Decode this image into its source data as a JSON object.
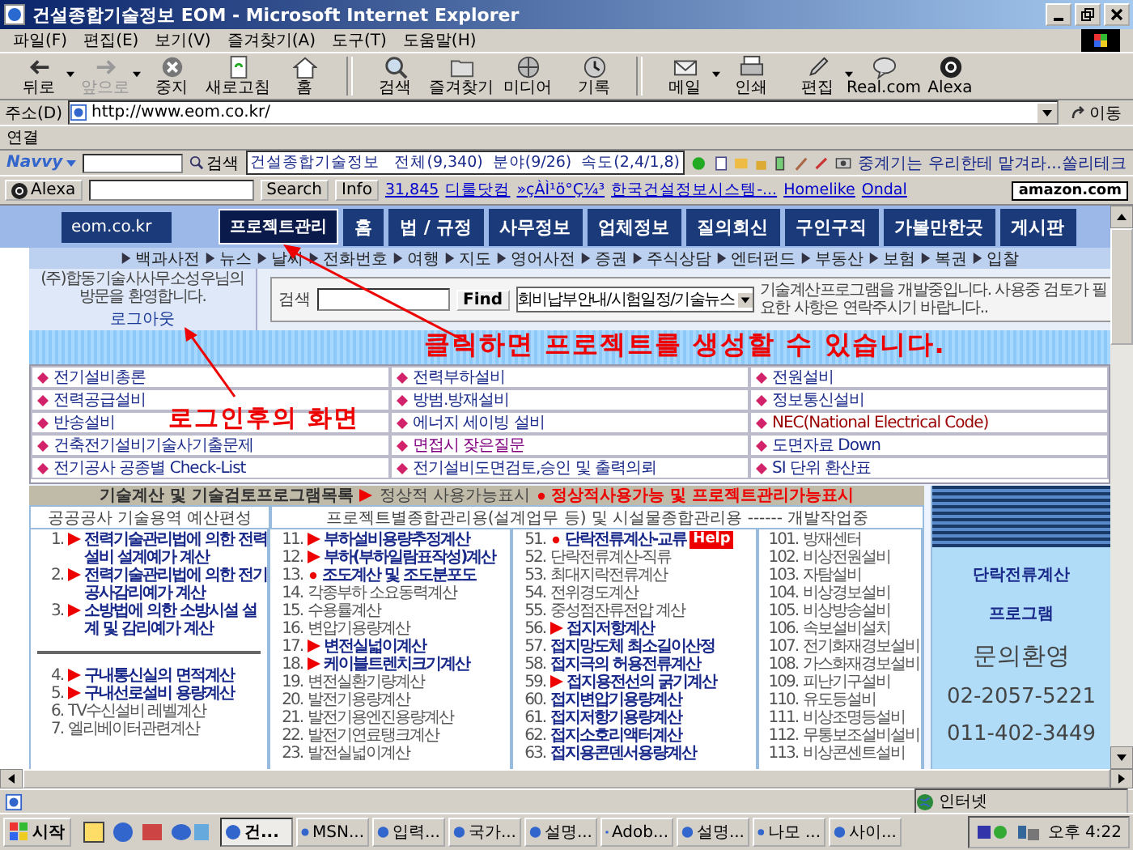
{
  "window": {
    "title": "건설종합기술정보 EOM - Microsoft Internet Explorer"
  },
  "menu": [
    "파일(F)",
    "편집(E)",
    "보기(V)",
    "즐겨찾기(A)",
    "도구(T)",
    "도움말(H)"
  ],
  "toolbar": [
    {
      "label": "뒤로",
      "disabled": false,
      "dropdown": true
    },
    {
      "label": "앞으로",
      "disabled": true,
      "dropdown": true
    },
    {
      "label": "중지",
      "disabled": false,
      "dropdown": false
    },
    {
      "label": "새로고침",
      "disabled": false,
      "dropdown": false
    },
    {
      "label": "홈",
      "disabled": false,
      "dropdown": false
    },
    {
      "label": "검색",
      "disabled": false,
      "dropdown": false
    },
    {
      "label": "즐겨찾기",
      "disabled": false,
      "dropdown": false
    },
    {
      "label": "미디어",
      "disabled": false,
      "dropdown": false
    },
    {
      "label": "기록",
      "disabled": false,
      "dropdown": false
    },
    {
      "label": "메일",
      "disabled": false,
      "dropdown": true
    },
    {
      "label": "인쇄",
      "disabled": false,
      "dropdown": false
    },
    {
      "label": "편집",
      "disabled": false,
      "dropdown": true
    },
    {
      "label": "Real.com",
      "disabled": false,
      "dropdown": false
    },
    {
      "label": "Alexa",
      "disabled": false,
      "dropdown": false
    }
  ],
  "address": {
    "label": "주소(D)",
    "value": "http://www.eom.co.kr/",
    "go": "이동"
  },
  "links_bar": {
    "label": "연결"
  },
  "navvy_bar": {
    "brand": "Navvy",
    "search": "검색",
    "info": "건설종합기술정보   전체(9,340)  분야(9/26)  속도(2,4/1,8)",
    "ticker": "중계기는 우리한테 맡겨라...쏠리테크"
  },
  "alexa_bar": {
    "brand": "Alexa",
    "search": "Search",
    "info": "Info",
    "rank": "31,845",
    "links": [
      "디룰닷컴",
      "»çÀÌ¹ö°Ç¼³",
      "한국건설정보시스템-...",
      "Homelike",
      "Ondal"
    ],
    "amazon": "amazon.com"
  },
  "site": {
    "domain": "eom.co.kr",
    "tabs": [
      {
        "label": "프로젝트관리",
        "selected": true
      },
      {
        "label": "홈",
        "selected": false
      },
      {
        "label": "법 / 규정",
        "selected": false
      },
      {
        "label": "사무정보",
        "selected": false
      },
      {
        "label": "업체정보",
        "selected": false
      },
      {
        "label": "질의회신",
        "selected": false
      },
      {
        "label": "구인구직",
        "selected": false
      },
      {
        "label": "가볼만한곳",
        "selected": false
      },
      {
        "label": "게시판",
        "selected": false
      }
    ],
    "subnav": [
      "백과사전",
      "뉴스",
      "날씨",
      "전화번호",
      "여행",
      "지도",
      "영어사전",
      "증권",
      "주식상담",
      "엔터펀드",
      "부동산",
      "보험",
      "복권",
      "입찰"
    ],
    "login": {
      "greeting": "(주)합동기술사사무소성우님의 방문을 환영합니다.",
      "logout": "로그아웃"
    },
    "search": {
      "label": "검색",
      "button": "Find",
      "select": "회비납부안내/시험일정/기술뉴스",
      "notice": "기술계산프로그램을 개발중입니다. 사용중 검토가 필요한 사항은 연락주시기 바랍니다.."
    },
    "link_grid": [
      [
        {
          "text": "전기설비총론",
          "color": "#1a2a8a"
        },
        {
          "text": "전력부하설비",
          "color": "#1a2a8a"
        },
        {
          "text": "전원설비",
          "color": "#1a2a8a"
        }
      ],
      [
        {
          "text": "전력공급설비",
          "color": "#1a2a8a"
        },
        {
          "text": "방범.방재설비",
          "color": "#1a2a8a"
        },
        {
          "text": "정보통신설비",
          "color": "#1a2a8a"
        }
      ],
      [
        {
          "text": "반송설비",
          "color": "#1a2a8a"
        },
        {
          "text": "에너지 세이빙 설비",
          "color": "#1a2a8a"
        },
        {
          "text": "NEC(National Electrical Code)",
          "color": "#990000"
        }
      ],
      [
        {
          "text": "건축전기설비기술사기출문제",
          "color": "#1a2a8a"
        },
        {
          "text": "면접시 잦은질문",
          "color": "#800080"
        },
        {
          "text": "도면자료 Down",
          "color": "#1a2a8a"
        }
      ],
      [
        {
          "text": "전기공사 공종별 Check-List",
          "color": "#1a2a8a"
        },
        {
          "text": "전기설비도면검토,승인 및 출력의뢰",
          "color": "#1a2a8a"
        },
        {
          "text": "SI 단위 환산표",
          "color": "#1a2a8a"
        }
      ]
    ],
    "programs": {
      "title": "기술계산 및 기술검토프로그램목록",
      "legend_arrow": "정상적 사용가능표시",
      "legend_dot": "정상적사용가능 및 프로젝트관리가능표시",
      "headings": [
        "공공공사 기술용역 예산편성",
        "프로젝트별종합관리용(설계업무 등) 및 시설물종합관리용 ------ 개발작업중"
      ],
      "columns": [
        {
          "groups": [
            [
              {
                "num": "1.",
                "text": "전력기술관리법에 의한 전력설비 설계예가 계산",
                "kind": "arrow",
                "link": true
              },
              {
                "num": "2.",
                "text": "전력기술관리법에 의한 전기공사감리예가 계산",
                "kind": "arrow",
                "link": true
              },
              {
                "num": "3.",
                "text": "소방법에 의한 소방시설 설계 및 감리예가 계산",
                "kind": "arrow",
                "link": true
              }
            ],
            [
              {
                "num": "4.",
                "text": "구내통신실의 면적계산",
                "kind": "arrow",
                "link": true
              },
              {
                "num": "5.",
                "text": "구내선로설비 용량계산",
                "kind": "arrow",
                "link": true
              },
              {
                "num": "6.",
                "text": "TV수신설비 레벨계산",
                "kind": "plain",
                "link": false
              },
              {
                "num": "7.",
                "text": "엘리베이터관련계산",
                "kind": "plain",
                "link": false
              }
            ]
          ]
        },
        {
          "groups": [
            [
              {
                "num": "11.",
                "text": "부하설비용량추정계산",
                "kind": "arrow",
                "link": true
              },
              {
                "num": "12.",
                "text": "부하(부하일람표작성)계산",
                "kind": "arrow",
                "link": true
              },
              {
                "num": "13.",
                "text": "조도계산 및 조도분포도",
                "kind": "dot",
                "link": true
              },
              {
                "num": "14.",
                "text": "각종부하 소요동력계산",
                "kind": "plain",
                "link": false
              },
              {
                "num": "15.",
                "text": "수용률계산",
                "kind": "plain",
                "link": false
              },
              {
                "num": "16.",
                "text": "변압기용량계산",
                "kind": "plain",
                "link": false
              },
              {
                "num": "17.",
                "text": "변전실넓이계산",
                "kind": "arrow",
                "link": true
              },
              {
                "num": "18.",
                "text": "케이블트렌치크기계산",
                "kind": "arrow",
                "link": true
              },
              {
                "num": "19.",
                "text": "변전실환기량계산",
                "kind": "plain",
                "link": false
              },
              {
                "num": "20.",
                "text": "발전기용량계산",
                "kind": "plain",
                "link": false
              },
              {
                "num": "21.",
                "text": "발전기용엔진용량계산",
                "kind": "plain",
                "link": false
              },
              {
                "num": "22.",
                "text": "발전기연료탱크계산",
                "kind": "plain",
                "link": false
              },
              {
                "num": "23.",
                "text": "발전실넓이계산",
                "kind": "plain",
                "link": false
              }
            ]
          ]
        },
        {
          "groups": [
            [
              {
                "num": "51.",
                "text": "단락전류계산-교류",
                "kind": "dot",
                "link": true,
                "badge": "Help"
              },
              {
                "num": "52.",
                "text": "단락전류계산-직류",
                "kind": "plain",
                "link": false
              },
              {
                "num": "53.",
                "text": "최대지락전류계산",
                "kind": "plain",
                "link": false
              },
              {
                "num": "54.",
                "text": "전위경도계산",
                "kind": "plain",
                "link": false
              },
              {
                "num": "55.",
                "text": "중성점잔류전압 계산",
                "kind": "plain",
                "link": false
              },
              {
                "num": "56.",
                "text": "접지저항계산",
                "kind": "arrow",
                "link": true
              },
              {
                "num": "57.",
                "text": "접지망도체 최소길이산정",
                "kind": "plain",
                "link": true
              },
              {
                "num": "58.",
                "text": "접지극의 허용전류계산",
                "kind": "plain",
                "link": true
              },
              {
                "num": "59.",
                "text": "접지용전선의 굵기계산",
                "kind": "arrow",
                "link": true
              },
              {
                "num": "60.",
                "text": "접지변압기용량계산",
                "kind": "plain",
                "link": true
              },
              {
                "num": "61.",
                "text": "접지저항기용량계산",
                "kind": "plain",
                "link": true
              },
              {
                "num": "62.",
                "text": "접지소호리액터계산",
                "kind": "plain",
                "link": true
              },
              {
                "num": "63.",
                "text": "접지용콘덴서용량계산",
                "kind": "plain",
                "link": true
              }
            ]
          ]
        },
        {
          "groups": [
            [
              {
                "num": "101.",
                "text": "방재센터",
                "kind": "plain",
                "link": false
              },
              {
                "num": "102.",
                "text": "비상전원설비",
                "kind": "plain",
                "link": false
              },
              {
                "num": "103.",
                "text": "자탐설비",
                "kind": "plain",
                "link": false
              },
              {
                "num": "104.",
                "text": "비상경보설비",
                "kind": "plain",
                "link": false
              },
              {
                "num": "105.",
                "text": "비상방송설비",
                "kind": "plain",
                "link": false
              },
              {
                "num": "106.",
                "text": "속보설비설치",
                "kind": "plain",
                "link": false
              },
              {
                "num": "107.",
                "text": "전기화재경보설비",
                "kind": "plain",
                "link": false
              },
              {
                "num": "108.",
                "text": "가스화재경보설비",
                "kind": "plain",
                "link": false
              },
              {
                "num": "109.",
                "text": "피난기구설비",
                "kind": "plain",
                "link": false
              },
              {
                "num": "110.",
                "text": "유도등설비",
                "kind": "plain",
                "link": false
              },
              {
                "num": "111.",
                "text": "비상조명등설비",
                "kind": "plain",
                "link": false
              },
              {
                "num": "112.",
                "text": "무통보조설비설비",
                "kind": "plain",
                "link": false
              },
              {
                "num": "113.",
                "text": "비상콘센트설비",
                "kind": "plain",
                "link": false
              }
            ]
          ]
        }
      ]
    },
    "ad": {
      "lines": [
        "단락전류계산",
        "프로그램"
      ],
      "contact": "문의환영",
      "phones": [
        "02-2057-5221",
        "011-402-3449"
      ]
    }
  },
  "annotations": {
    "project_note": "클릭하면 프로젝트를 생성할 수 있습니다.",
    "login_note": "로그인후의 화면"
  },
  "status_bar": {
    "zone": "인터넷"
  },
  "taskbar": {
    "start": "시작",
    "tasks": [
      {
        "label": "건...",
        "selected": true
      },
      {
        "label": "MSN...",
        "selected": false
      },
      {
        "label": "입력...",
        "selected": false
      },
      {
        "label": "국가...",
        "selected": false
      },
      {
        "label": "설명...",
        "selected": false
      },
      {
        "label": "Adob...",
        "selected": false
      },
      {
        "label": "설명...",
        "selected": false
      },
      {
        "label": "나모 ...",
        "selected": false
      },
      {
        "label": "사이...",
        "selected": false
      }
    ],
    "clock": "오후 4:22"
  }
}
